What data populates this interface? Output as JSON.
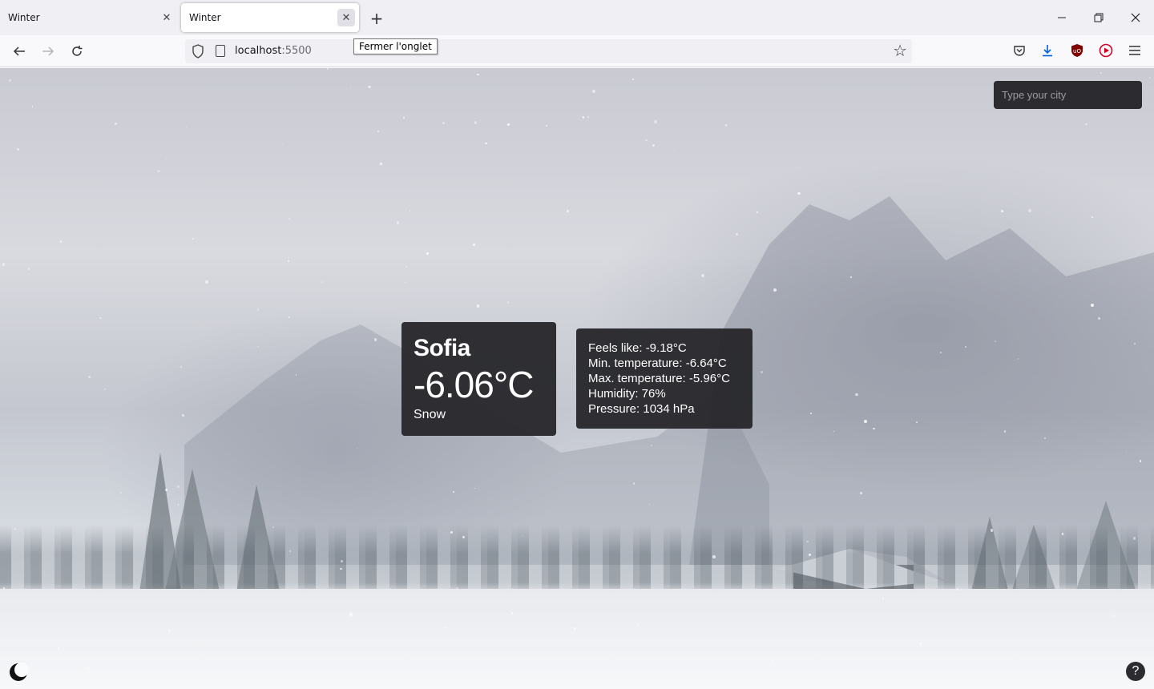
{
  "browser": {
    "tabs": [
      {
        "title": "Winter",
        "active": false
      },
      {
        "title": "Winter",
        "active": true
      }
    ],
    "new_tab_label": "+",
    "close_tab_tooltip": "Fermer l'onglet",
    "url_host": "localhost",
    "url_port": ":5500",
    "icons": {
      "back": "back-arrow-icon",
      "forward": "forward-arrow-icon",
      "reload": "reload-icon",
      "bookmark": "star-icon",
      "pocket": "pocket-icon",
      "downloads": "download-icon",
      "ublock": "ublock-icon",
      "extension": "play-icon",
      "menu": "hamburger-menu-icon"
    },
    "accent_colors": {
      "download": "#0060df",
      "ublock": "#800000",
      "extension": "#d70022"
    }
  },
  "app": {
    "search": {
      "placeholder": "Type your city",
      "value": ""
    },
    "weather": {
      "city": "Sofia",
      "temperature": "-6.06°C",
      "description": "Snow"
    },
    "details": {
      "feels_like": "Feels like: -9.18°C",
      "min_temp": "Min. temperature: -6.64°C",
      "max_temp": "Max. temperature: -5.96°C",
      "humidity": "Humidity: 76%",
      "pressure": "Pressure: 1034 hPa"
    },
    "help_label": "?",
    "theme_icon": "moon-icon"
  }
}
